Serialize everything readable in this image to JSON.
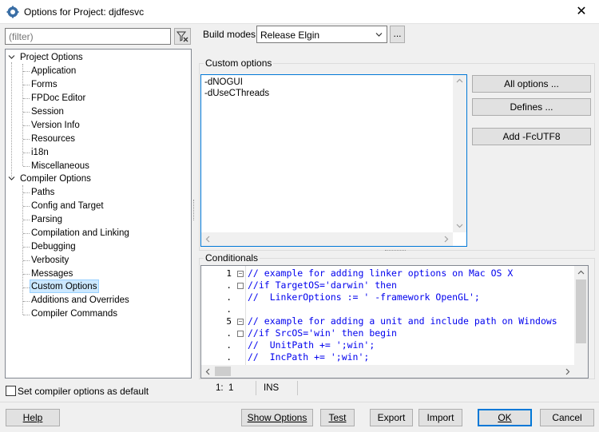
{
  "window": {
    "title": "Options for Project: djdfesvc",
    "close_glyph": "✕"
  },
  "filter": {
    "placeholder": "(filter)",
    "value": ""
  },
  "tree": {
    "project_options": {
      "label": "Project Options",
      "children": [
        "Application",
        "Forms",
        "FPDoc Editor",
        "Session",
        "Version Info",
        "Resources",
        "i18n",
        "Miscellaneous"
      ]
    },
    "compiler_options": {
      "label": "Compiler Options",
      "children": [
        "Paths",
        "Config and Target",
        "Parsing",
        "Compilation and Linking",
        "Debugging",
        "Verbosity",
        "Messages",
        "Custom Options",
        "Additions and Overrides",
        "Compiler Commands"
      ]
    },
    "selected": "Custom Options"
  },
  "build_modes": {
    "label": "Build modes",
    "value": "Release Elgin",
    "more_button": "..."
  },
  "custom_options": {
    "caption": "Custom options",
    "lines": [
      "-dNOGUI",
      "-dUseCThreads"
    ]
  },
  "side_buttons": {
    "all_options": "All options ...",
    "defines": "Defines ...",
    "add_fcutf8": "Add -FcUTF8"
  },
  "conditionals": {
    "caption": "Conditionals",
    "lines": [
      {
        "num": "1",
        "text": "// example for adding linker options on Mac OS X"
      },
      {
        "num": ".",
        "text": "//if TargetOS='darwin' then"
      },
      {
        "num": ".",
        "text": "//  LinkerOptions := ' -framework OpenGL';"
      },
      {
        "num": ".",
        "text": ""
      },
      {
        "num": "5",
        "text": "// example for adding a unit and include path on Windows"
      },
      {
        "num": ".",
        "text": "//if SrcOS='win' then begin"
      },
      {
        "num": ".",
        "text": "//  UnitPath += ';win';"
      },
      {
        "num": ".",
        "text": "//  IncPath += ';win';"
      }
    ]
  },
  "statusbar": {
    "position": "1:  1",
    "mode": "INS"
  },
  "checkbox": {
    "label": "Set compiler options as default",
    "checked": false
  },
  "bottom_buttons": {
    "help": "Help",
    "show_options": "Show Options",
    "test": "Test",
    "export": "Export",
    "import": "Import",
    "ok": "OK",
    "cancel": "Cancel"
  },
  "colors": {
    "code_text": "#0000ee",
    "selection": "#cce8ff",
    "focus_border": "#0078d7"
  }
}
